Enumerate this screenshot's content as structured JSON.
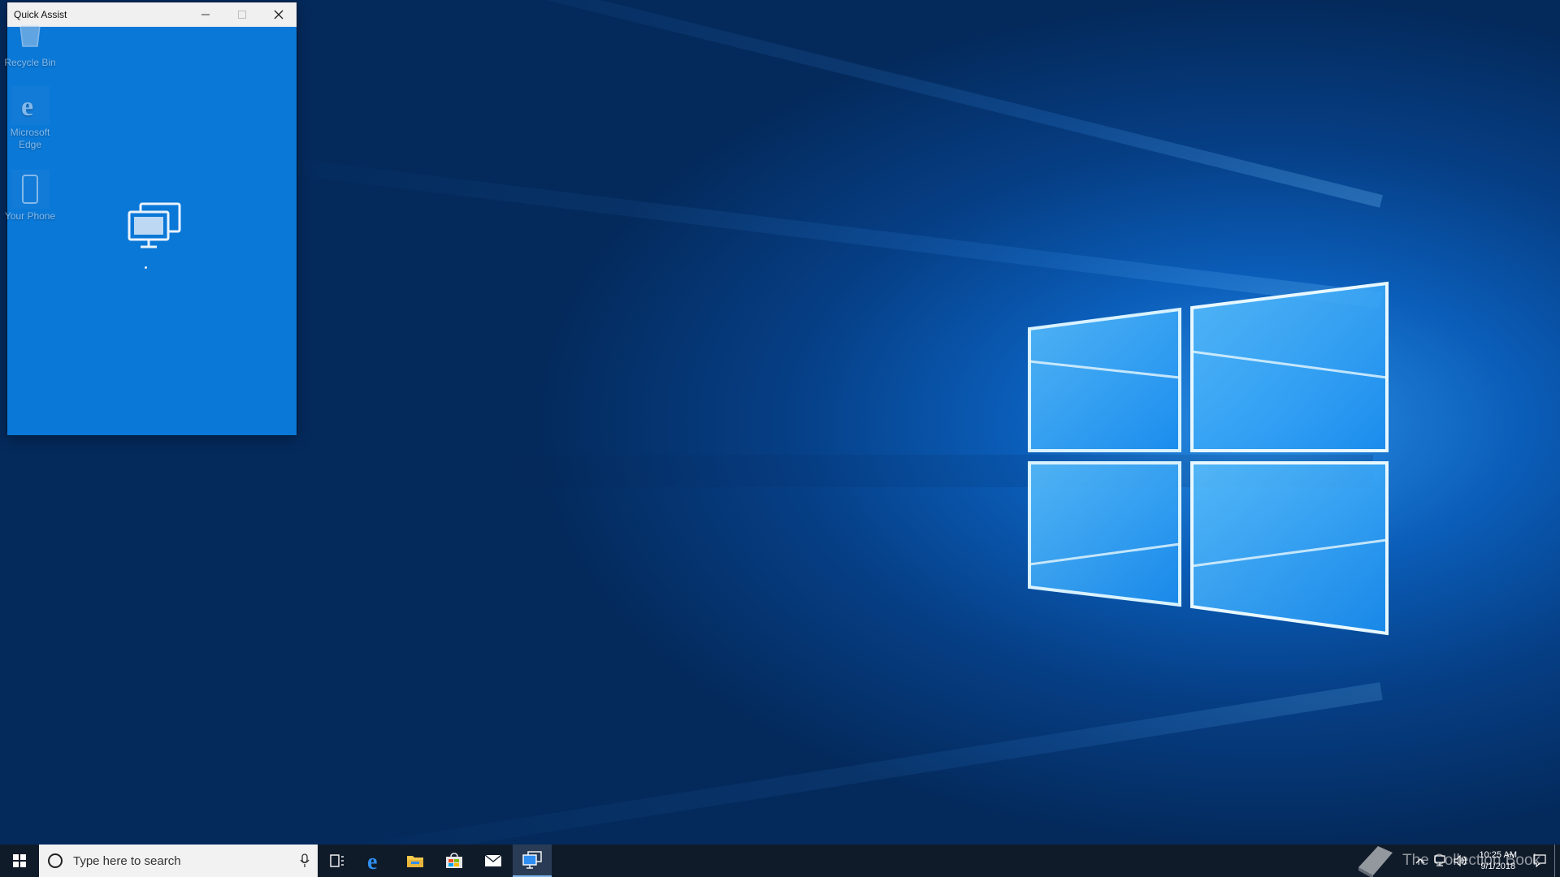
{
  "window": {
    "title": "Quick Assist",
    "minimize_icon": "minimize-icon",
    "maximize_icon": "maximize-icon",
    "close_icon": "close-icon",
    "background_color": "#0a78d7"
  },
  "desktop": {
    "icons": [
      {
        "label": "Recycle Bin",
        "icon": "recycle-bin-icon"
      },
      {
        "label": "Microsoft Edge",
        "icon": "edge-icon"
      },
      {
        "label": "Your Phone",
        "icon": "phone-icon"
      }
    ]
  },
  "taskbar": {
    "search_placeholder": "Type here to search",
    "items": [
      {
        "name": "start",
        "icon": "windows-start-icon"
      },
      {
        "name": "task-view",
        "icon": "task-view-icon"
      },
      {
        "name": "edge",
        "icon": "edge-icon"
      },
      {
        "name": "file-explorer",
        "icon": "folder-icon"
      },
      {
        "name": "store",
        "icon": "store-icon"
      },
      {
        "name": "mail",
        "icon": "mail-icon"
      },
      {
        "name": "quick-assist",
        "icon": "quick-assist-icon",
        "active": true
      }
    ],
    "clock": {
      "time": "10:25 AM",
      "date": "9/1/2018"
    }
  },
  "watermark": {
    "text": "The Collection Book"
  }
}
